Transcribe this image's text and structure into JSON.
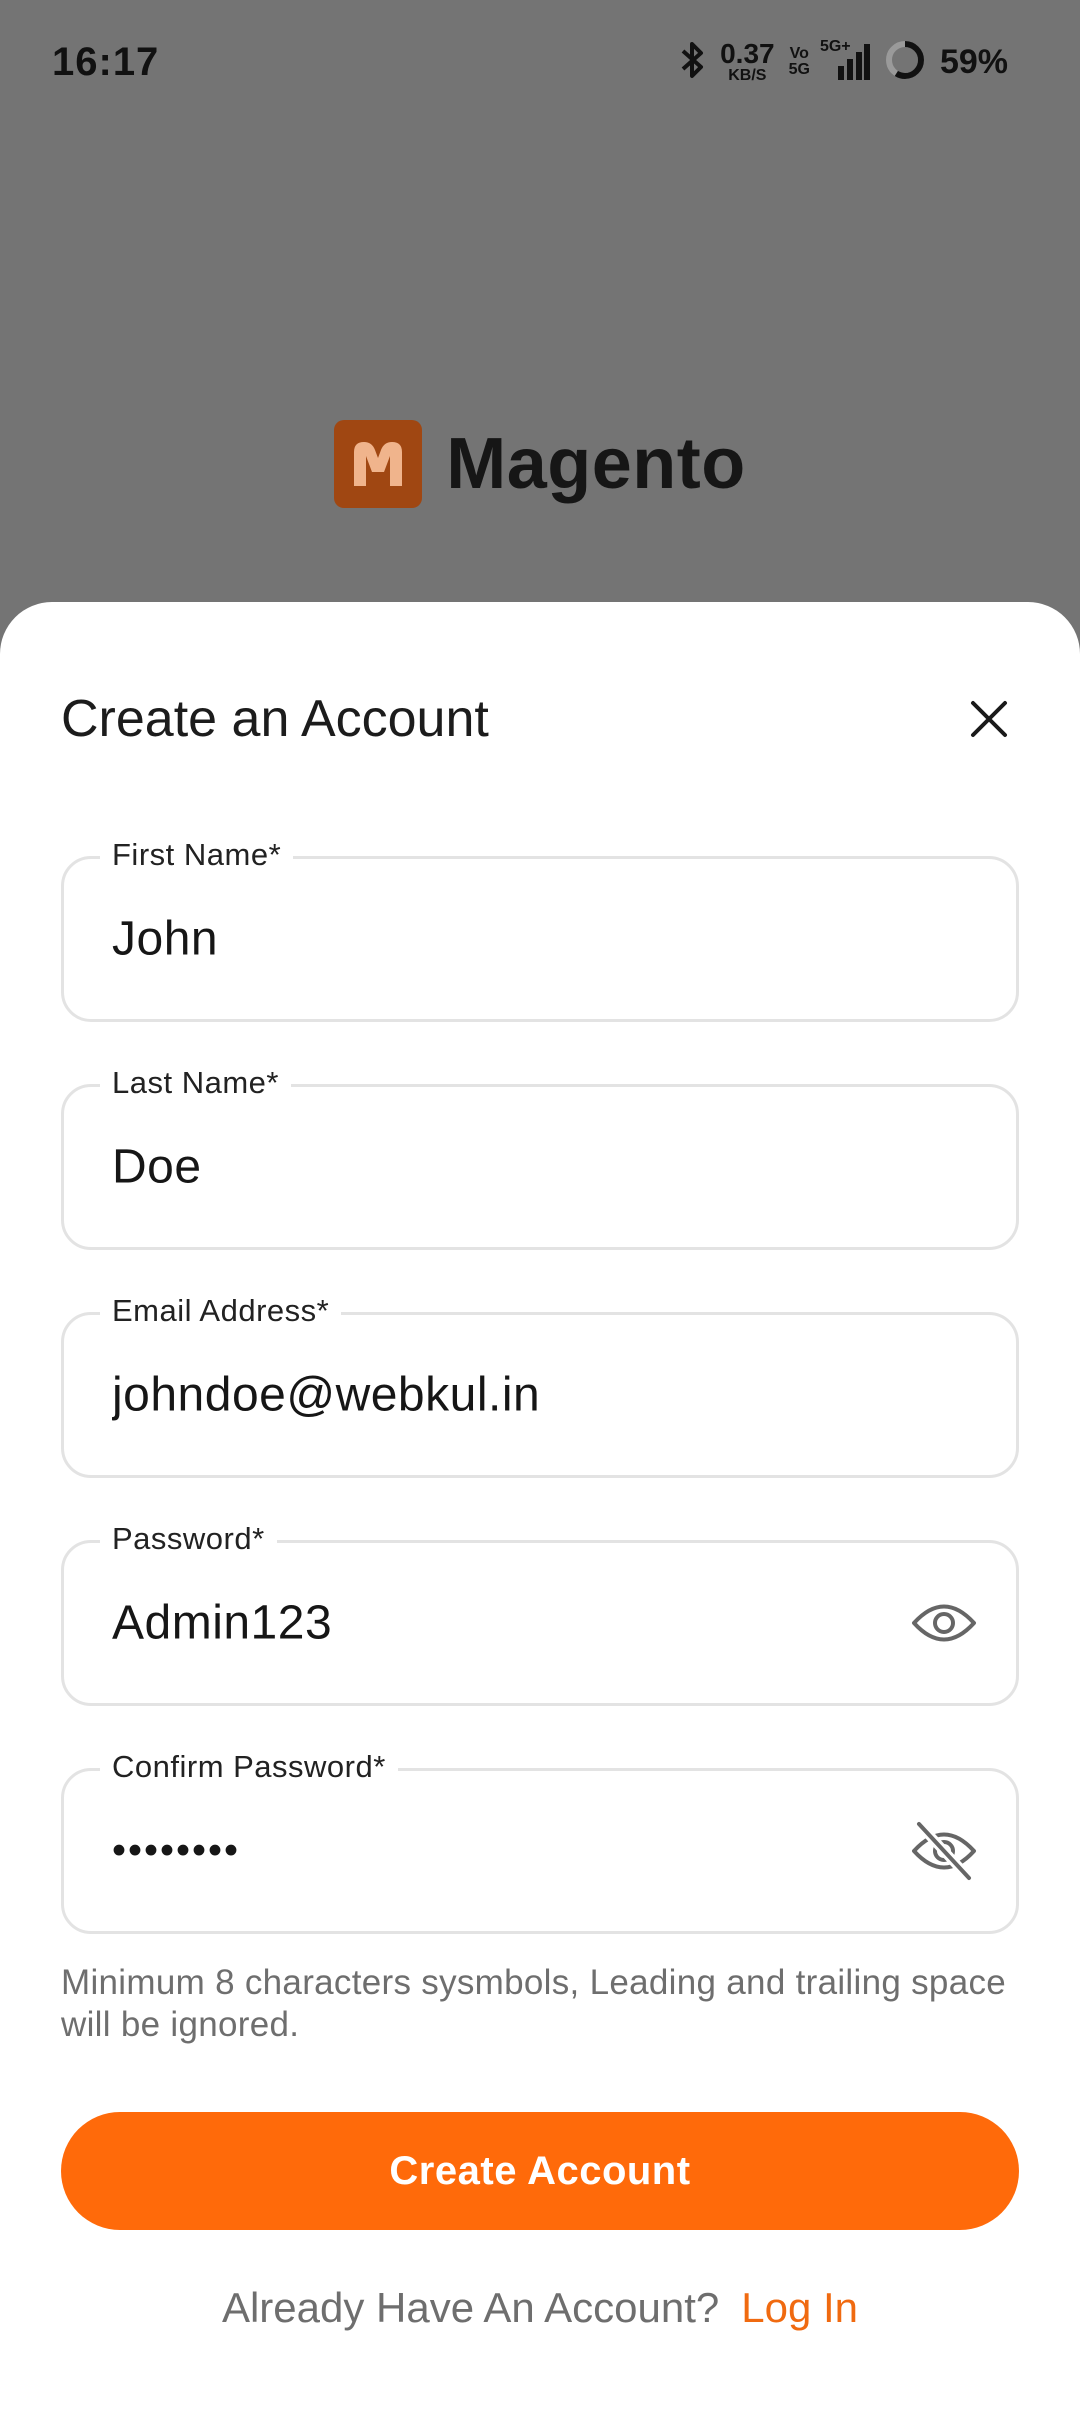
{
  "status_bar": {
    "time": "16:17",
    "net_speed_value": "0.37",
    "net_speed_unit": "KB/S",
    "volte_top": "Vo",
    "volte_bottom": "5G",
    "network": "5G+",
    "battery_percent": "59%",
    "battery_level": 0.59
  },
  "app": {
    "brand": "Magento",
    "brand_color": "#a04712"
  },
  "sheet": {
    "title": "Create an Account"
  },
  "form": {
    "first_name": {
      "label": "First Name*",
      "value": "John"
    },
    "last_name": {
      "label": "Last Name*",
      "value": "Doe"
    },
    "email": {
      "label": "Email Address*",
      "value": "johndoe@webkul.in"
    },
    "password": {
      "label": "Password*",
      "value": "Admin123",
      "visible": true
    },
    "confirm_password": {
      "label": "Confirm Password*",
      "value": "••••••••",
      "visible": false
    },
    "hint": "Minimum 8 characters sysmbols, Leading and trailing space will be ignored."
  },
  "actions": {
    "create_label": "Create Account",
    "accent_color": "#ff6a0a"
  },
  "footer": {
    "prompt": "Already Have An Account?",
    "login_label": "Log In"
  },
  "icons": {
    "close": "close-icon",
    "eye_open": "eye-icon",
    "eye_off": "eye-off-icon"
  }
}
